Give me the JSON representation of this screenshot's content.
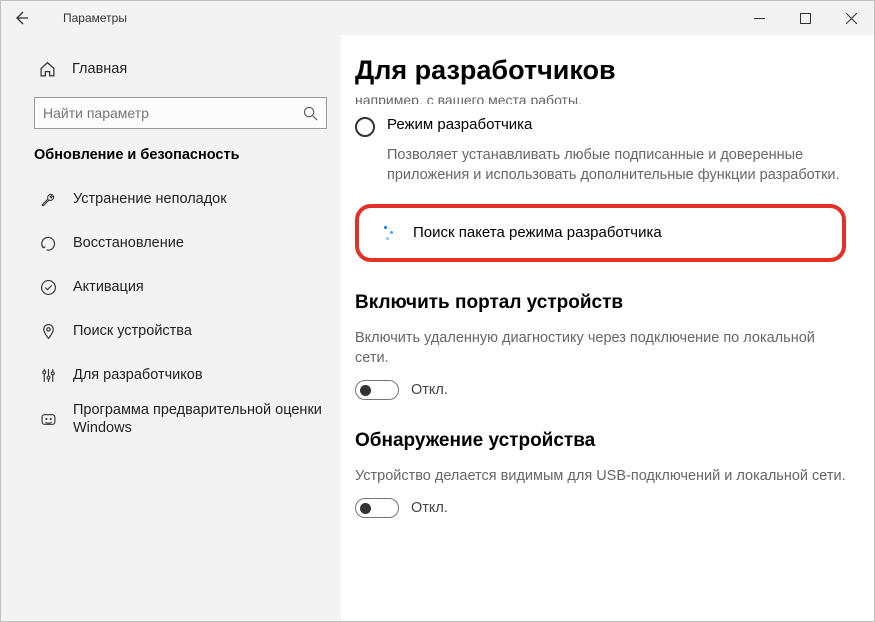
{
  "titlebar": {
    "app_title": "Параметры"
  },
  "sidebar": {
    "home_label": "Главная",
    "search_placeholder": "Найти параметр",
    "section_title": "Обновление и безопасность",
    "items": [
      {
        "label": "Устранение неполадок"
      },
      {
        "label": "Восстановление"
      },
      {
        "label": "Активация"
      },
      {
        "label": "Поиск устройства"
      },
      {
        "label": "Для разработчиков"
      },
      {
        "label": "Программа предварительной оценки Windows"
      }
    ]
  },
  "content": {
    "page_title": "Для разработчиков",
    "clipped_line": "например, с вашего места работы.",
    "dev_mode": {
      "label": "Режим разработчика",
      "desc": "Позволяет устанавливать любые подписанные и доверенные приложения и использовать дополнительные функции разработки."
    },
    "searching_text": "Поиск пакета режима разработчика",
    "portal": {
      "heading": "Включить портал устройств",
      "desc": "Включить удаленную диагностику через подключение по локальной сети.",
      "toggle_label": "Откл."
    },
    "discovery": {
      "heading": "Обнаружение устройства",
      "desc": "Устройство делается видимым для USB-подключений и локальной сети.",
      "toggle_label": "Откл."
    }
  }
}
